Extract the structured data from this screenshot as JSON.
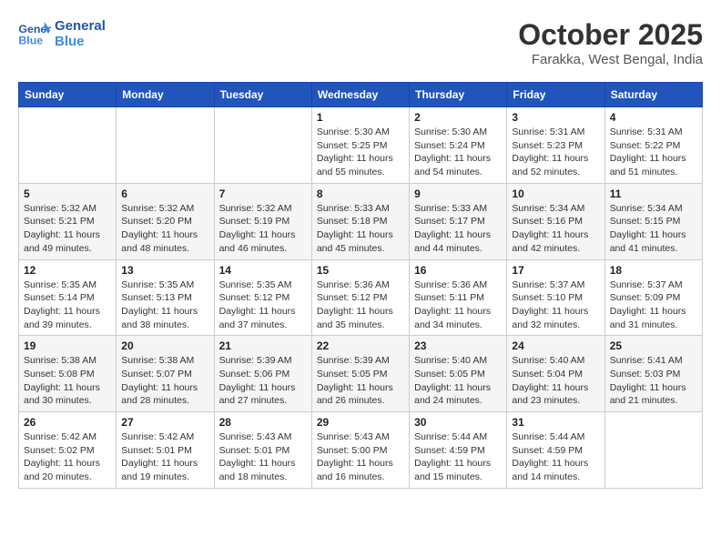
{
  "header": {
    "logo_line1": "General",
    "logo_line2": "Blue",
    "month": "October 2025",
    "location": "Farakka, West Bengal, India"
  },
  "weekdays": [
    "Sunday",
    "Monday",
    "Tuesday",
    "Wednesday",
    "Thursday",
    "Friday",
    "Saturday"
  ],
  "weeks": [
    [
      {
        "day": "",
        "sunrise": "",
        "sunset": "",
        "daylight": ""
      },
      {
        "day": "",
        "sunrise": "",
        "sunset": "",
        "daylight": ""
      },
      {
        "day": "",
        "sunrise": "",
        "sunset": "",
        "daylight": ""
      },
      {
        "day": "1",
        "sunrise": "Sunrise: 5:30 AM",
        "sunset": "Sunset: 5:25 PM",
        "daylight": "Daylight: 11 hours and 55 minutes."
      },
      {
        "day": "2",
        "sunrise": "Sunrise: 5:30 AM",
        "sunset": "Sunset: 5:24 PM",
        "daylight": "Daylight: 11 hours and 54 minutes."
      },
      {
        "day": "3",
        "sunrise": "Sunrise: 5:31 AM",
        "sunset": "Sunset: 5:23 PM",
        "daylight": "Daylight: 11 hours and 52 minutes."
      },
      {
        "day": "4",
        "sunrise": "Sunrise: 5:31 AM",
        "sunset": "Sunset: 5:22 PM",
        "daylight": "Daylight: 11 hours and 51 minutes."
      }
    ],
    [
      {
        "day": "5",
        "sunrise": "Sunrise: 5:32 AM",
        "sunset": "Sunset: 5:21 PM",
        "daylight": "Daylight: 11 hours and 49 minutes."
      },
      {
        "day": "6",
        "sunrise": "Sunrise: 5:32 AM",
        "sunset": "Sunset: 5:20 PM",
        "daylight": "Daylight: 11 hours and 48 minutes."
      },
      {
        "day": "7",
        "sunrise": "Sunrise: 5:32 AM",
        "sunset": "Sunset: 5:19 PM",
        "daylight": "Daylight: 11 hours and 46 minutes."
      },
      {
        "day": "8",
        "sunrise": "Sunrise: 5:33 AM",
        "sunset": "Sunset: 5:18 PM",
        "daylight": "Daylight: 11 hours and 45 minutes."
      },
      {
        "day": "9",
        "sunrise": "Sunrise: 5:33 AM",
        "sunset": "Sunset: 5:17 PM",
        "daylight": "Daylight: 11 hours and 44 minutes."
      },
      {
        "day": "10",
        "sunrise": "Sunrise: 5:34 AM",
        "sunset": "Sunset: 5:16 PM",
        "daylight": "Daylight: 11 hours and 42 minutes."
      },
      {
        "day": "11",
        "sunrise": "Sunrise: 5:34 AM",
        "sunset": "Sunset: 5:15 PM",
        "daylight": "Daylight: 11 hours and 41 minutes."
      }
    ],
    [
      {
        "day": "12",
        "sunrise": "Sunrise: 5:35 AM",
        "sunset": "Sunset: 5:14 PM",
        "daylight": "Daylight: 11 hours and 39 minutes."
      },
      {
        "day": "13",
        "sunrise": "Sunrise: 5:35 AM",
        "sunset": "Sunset: 5:13 PM",
        "daylight": "Daylight: 11 hours and 38 minutes."
      },
      {
        "day": "14",
        "sunrise": "Sunrise: 5:35 AM",
        "sunset": "Sunset: 5:12 PM",
        "daylight": "Daylight: 11 hours and 37 minutes."
      },
      {
        "day": "15",
        "sunrise": "Sunrise: 5:36 AM",
        "sunset": "Sunset: 5:12 PM",
        "daylight": "Daylight: 11 hours and 35 minutes."
      },
      {
        "day": "16",
        "sunrise": "Sunrise: 5:36 AM",
        "sunset": "Sunset: 5:11 PM",
        "daylight": "Daylight: 11 hours and 34 minutes."
      },
      {
        "day": "17",
        "sunrise": "Sunrise: 5:37 AM",
        "sunset": "Sunset: 5:10 PM",
        "daylight": "Daylight: 11 hours and 32 minutes."
      },
      {
        "day": "18",
        "sunrise": "Sunrise: 5:37 AM",
        "sunset": "Sunset: 5:09 PM",
        "daylight": "Daylight: 11 hours and 31 minutes."
      }
    ],
    [
      {
        "day": "19",
        "sunrise": "Sunrise: 5:38 AM",
        "sunset": "Sunset: 5:08 PM",
        "daylight": "Daylight: 11 hours and 30 minutes."
      },
      {
        "day": "20",
        "sunrise": "Sunrise: 5:38 AM",
        "sunset": "Sunset: 5:07 PM",
        "daylight": "Daylight: 11 hours and 28 minutes."
      },
      {
        "day": "21",
        "sunrise": "Sunrise: 5:39 AM",
        "sunset": "Sunset: 5:06 PM",
        "daylight": "Daylight: 11 hours and 27 minutes."
      },
      {
        "day": "22",
        "sunrise": "Sunrise: 5:39 AM",
        "sunset": "Sunset: 5:05 PM",
        "daylight": "Daylight: 11 hours and 26 minutes."
      },
      {
        "day": "23",
        "sunrise": "Sunrise: 5:40 AM",
        "sunset": "Sunset: 5:05 PM",
        "daylight": "Daylight: 11 hours and 24 minutes."
      },
      {
        "day": "24",
        "sunrise": "Sunrise: 5:40 AM",
        "sunset": "Sunset: 5:04 PM",
        "daylight": "Daylight: 11 hours and 23 minutes."
      },
      {
        "day": "25",
        "sunrise": "Sunrise: 5:41 AM",
        "sunset": "Sunset: 5:03 PM",
        "daylight": "Daylight: 11 hours and 21 minutes."
      }
    ],
    [
      {
        "day": "26",
        "sunrise": "Sunrise: 5:42 AM",
        "sunset": "Sunset: 5:02 PM",
        "daylight": "Daylight: 11 hours and 20 minutes."
      },
      {
        "day": "27",
        "sunrise": "Sunrise: 5:42 AM",
        "sunset": "Sunset: 5:01 PM",
        "daylight": "Daylight: 11 hours and 19 minutes."
      },
      {
        "day": "28",
        "sunrise": "Sunrise: 5:43 AM",
        "sunset": "Sunset: 5:01 PM",
        "daylight": "Daylight: 11 hours and 18 minutes."
      },
      {
        "day": "29",
        "sunrise": "Sunrise: 5:43 AM",
        "sunset": "Sunset: 5:00 PM",
        "daylight": "Daylight: 11 hours and 16 minutes."
      },
      {
        "day": "30",
        "sunrise": "Sunrise: 5:44 AM",
        "sunset": "Sunset: 4:59 PM",
        "daylight": "Daylight: 11 hours and 15 minutes."
      },
      {
        "day": "31",
        "sunrise": "Sunrise: 5:44 AM",
        "sunset": "Sunset: 4:59 PM",
        "daylight": "Daylight: 11 hours and 14 minutes."
      },
      {
        "day": "",
        "sunrise": "",
        "sunset": "",
        "daylight": ""
      }
    ]
  ]
}
